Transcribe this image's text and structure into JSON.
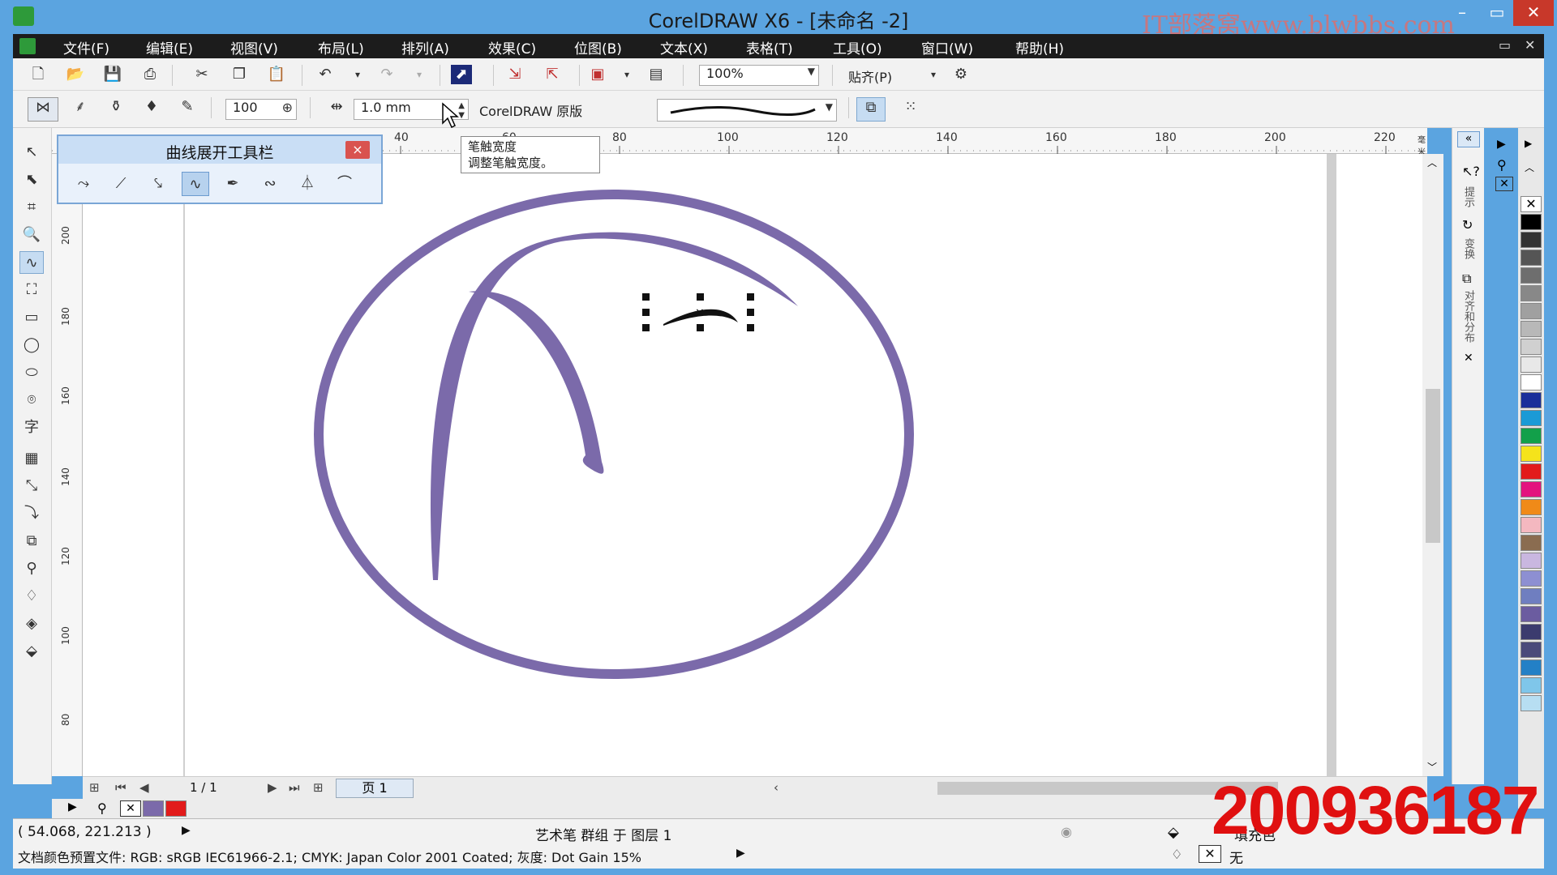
{
  "window": {
    "title": "CorelDRAW X6 - [未命名 -2]",
    "watermark": "IT部落窝www.blwbbs.com",
    "minimize": "–",
    "restore": "▭",
    "close": "✕"
  },
  "menu": {
    "items": [
      "文件(F)",
      "编辑(E)",
      "视图(V)",
      "布局(L)",
      "排列(A)",
      "效果(C)",
      "位图(B)",
      "文本(X)",
      "表格(T)",
      "工具(O)",
      "窗口(W)",
      "帮助(H)"
    ],
    "doc_restore": "▭",
    "doc_close": "✕"
  },
  "toolbar1": {
    "zoom_value": "100%",
    "snap_label": "贴齐(P)"
  },
  "toolbar2": {
    "width_value": "100",
    "stroke_width": "1.0 mm",
    "preset_label": "CorelDRAW 原版"
  },
  "curve_toolbar": {
    "title": "曲线展开工具栏",
    "close": "×"
  },
  "tooltip": {
    "line1": "笔触宽度",
    "line2": "调整笔触宽度。"
  },
  "ruler": {
    "top_labels": [
      "40",
      "60",
      "80",
      "100",
      "120",
      "140",
      "160",
      "180",
      "200",
      "220"
    ],
    "unit": "毫米",
    "left_labels": [
      "200",
      "180",
      "160",
      "140",
      "120",
      "100",
      "80"
    ]
  },
  "canvas": {
    "stroke_color": "#7b6aaa"
  },
  "pagebar": {
    "page_count": "1 / 1",
    "page_tab": "页 1"
  },
  "status": {
    "coordinates": "( 54.068, 221.213 )",
    "selection_info": "艺术笔 群组 于 图层 1",
    "color_profile": "文档颜色预置文件: RGB: sRGB IEC61966-2.1; CMYK: Japan Color 2001 Coated; 灰度: Dot Gain 15%",
    "fill_label": "填充色",
    "outline_label": "无"
  },
  "overlay_number": "200936187",
  "palette_colors": [
    "#000000",
    "#333333",
    "#555555",
    "#6e6e6e",
    "#888888",
    "#a0a0a0",
    "#b8b8b8",
    "#d0d0d0",
    "#e8e8e8",
    "#ffffff",
    "#1a2f9a",
    "#1b9ad6",
    "#12a04a",
    "#f5e31b",
    "#e21b1b",
    "#e3137e",
    "#f08a18",
    "#f4b8c0",
    "#8a6c50",
    "#c9b7e0",
    "#8d8fd2",
    "#6f7ec0",
    "#6b5ca0",
    "#3b3b6e",
    "#4a4a7a",
    "#2380c6",
    "#7fc6ea",
    "#b7def2"
  ]
}
